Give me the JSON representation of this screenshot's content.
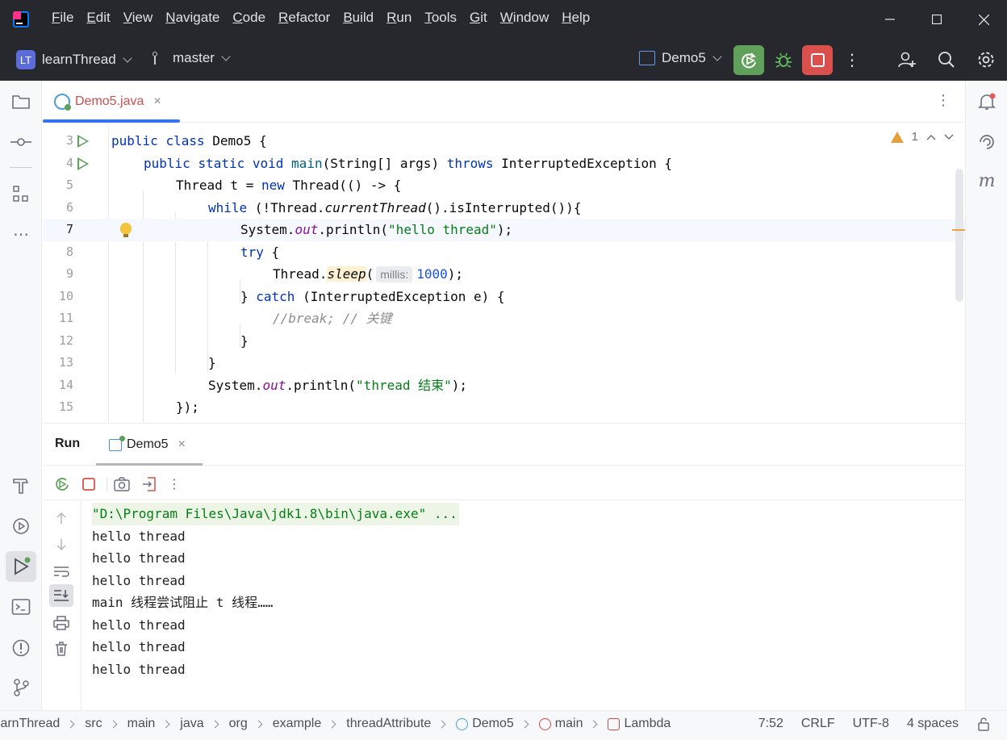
{
  "menubar": {
    "items": [
      "File",
      "Edit",
      "View",
      "Navigate",
      "Code",
      "Refactor",
      "Build",
      "Run",
      "Tools",
      "Git",
      "Window",
      "Help"
    ]
  },
  "toolbar": {
    "project_badge": "LT",
    "project_name": "learnThread",
    "branch": "master",
    "run_config": "Demo5"
  },
  "editor": {
    "tab_label": "Demo5.java",
    "warning_count": "1",
    "lines": [
      {
        "n": "3"
      },
      {
        "n": "4"
      },
      {
        "n": "5"
      },
      {
        "n": "6"
      },
      {
        "n": "7"
      },
      {
        "n": "8"
      },
      {
        "n": "9"
      },
      {
        "n": "10"
      },
      {
        "n": "11"
      },
      {
        "n": "12"
      },
      {
        "n": "13"
      },
      {
        "n": "14"
      },
      {
        "n": "15"
      }
    ],
    "code": {
      "l3_kw1": "public",
      "l3_kw2": "class",
      "l3_rest": " Demo5 {",
      "l4_kw1": "public",
      "l4_kw2": "static",
      "l4_kw3": "void",
      "l4_fn": "main",
      "l4_mid": "(String[] args) ",
      "l4_kw4": "throws",
      "l4_rest": " InterruptedException {",
      "l5_a": "Thread t = ",
      "l5_kw": "new",
      "l5_b": " Thread(() -> {",
      "l6_kw": "while",
      "l6_a": " (!Thread.",
      "l6_it": "currentThread",
      "l6_b": "().isInterrupted()){",
      "l7_a": "System.",
      "l7_fld": "out",
      "l7_b": ".println(",
      "l7_st": "\"hello thread\"",
      "l7_c": ");",
      "l8_kw": "try",
      "l8_rest": " {",
      "l9_a": "Thread.",
      "l9_it": "sleep",
      "l9_paren": "(",
      "l9_hint": "millis:",
      "l9_num": "1000",
      "l9_b": ");",
      "l10_a": "} ",
      "l10_kw": "catch",
      "l10_b": " (InterruptedException e) {",
      "l11_cm": "//break; // 关键",
      "l12": "}",
      "l13": "}",
      "l14_a": "System.",
      "l14_fld": "out",
      "l14_b": ".println(",
      "l14_st": "\"thread 结束\"",
      "l14_c": ");",
      "l15": "});"
    }
  },
  "run_panel": {
    "title": "Run",
    "tab_label": "Demo5",
    "console": [
      "\"D:\\Program Files\\Java\\jdk1.8\\bin\\java.exe\" ...",
      "hello thread",
      "hello thread",
      "hello thread",
      "main 线程尝试阻止 t 线程……",
      "hello thread",
      "hello thread",
      "hello thread"
    ]
  },
  "statusbar": {
    "crumbs": [
      "learnThread",
      "src",
      "main",
      "java",
      "org",
      "example",
      "threadAttribute",
      "Demo5",
      "main",
      "Lambda"
    ],
    "position": "7:52",
    "line_sep": "CRLF",
    "encoding": "UTF-8",
    "indent": "4 spaces"
  },
  "colors": {
    "header_bg": "#27282e",
    "run_green": "#5fa05a",
    "stop_red": "#d9504c",
    "accent_blue": "#3574f0"
  }
}
